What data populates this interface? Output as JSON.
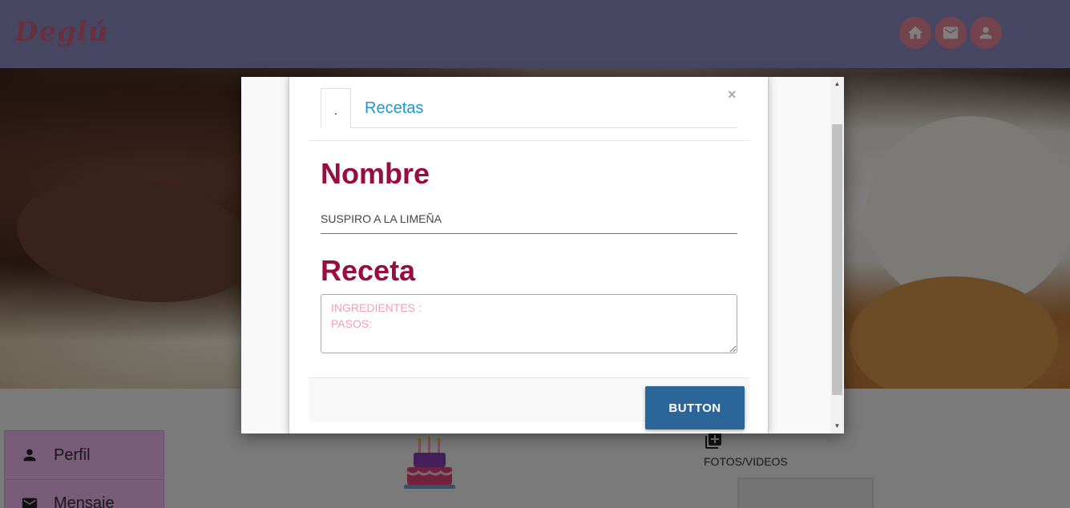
{
  "header": {
    "logo": "Deglú",
    "nav": [
      {
        "name": "home",
        "icon": "home-icon"
      },
      {
        "name": "mail",
        "icon": "mail-icon"
      },
      {
        "name": "profile",
        "icon": "person-icon"
      }
    ]
  },
  "sidebar": {
    "items": [
      {
        "label": "Perfil",
        "icon": "person-icon"
      },
      {
        "label": "Mensaje",
        "icon": "mail-icon"
      }
    ]
  },
  "content": {
    "media_label": "FOTOS/VIDEOS",
    "media_icon": "add-photo-library-icon",
    "cake_icon": "birthday-cake-icon"
  },
  "modal": {
    "tabs": [
      {
        "label": ".",
        "active": true
      },
      {
        "label": "Recetas",
        "active": false
      }
    ],
    "close_symbol": "×",
    "nombre_heading": "Nombre",
    "nombre_value": "SUSPIRO A LA LIMEÑA",
    "receta_heading": "Receta",
    "receta_placeholder": "INGREDIENTES :\nPASOS:",
    "receta_value": "",
    "submit_label": "BUTTON"
  },
  "colors": {
    "header_bg": "#8e8fc8",
    "accent": "#960d3e",
    "link": "#1a98d5",
    "button": "#2c6699",
    "sidebar_bg": "#f2b6f4"
  }
}
